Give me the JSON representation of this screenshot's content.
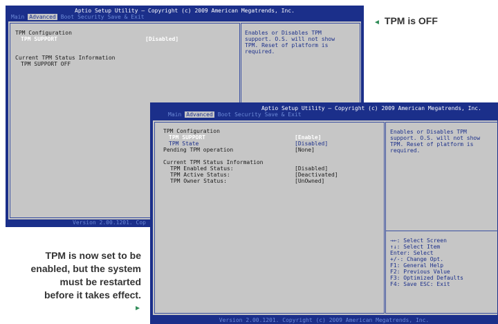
{
  "screen1": {
    "title": "Aptio Setup Utility – Copyright (c) 2009 American Megatrends, Inc.",
    "tabs": [
      "Main",
      "Advanced",
      "Boot",
      "Security",
      "Save & Exit"
    ],
    "section_title": "TPM Configuration",
    "tpm_support_label": "TPM SUPPORT",
    "tpm_support_value": "[Disabled]",
    "status_section": "Current TPM Status Information",
    "status_line": "TPM SUPPORT OFF",
    "help_text": "Enables or Disables TPM support. O.S. will not show TPM. Reset of platform is required.",
    "footer": "Version 2.00.1201. Cop"
  },
  "screen2": {
    "title": "Aptio Setup Utility – Copyright (c) 2009 American Megatrends, Inc.",
    "tabs": [
      "Main",
      "Advanced",
      "Boot",
      "Security",
      "Save & Exit"
    ],
    "section_title": "TPM Configuration",
    "rows": [
      {
        "label": "TPM SUPPORT",
        "value": "[Enable]"
      },
      {
        "label": "TPM State",
        "value": "[Disabled]"
      },
      {
        "label": "Pending TPM operation",
        "value": "[None]"
      }
    ],
    "status_section": "Current TPM Status Information",
    "status_rows": [
      {
        "label": "TPM Enabled Status:",
        "value": "[Disabled]"
      },
      {
        "label": "TPM Active Status:",
        "value": "[Deactivated]"
      },
      {
        "label": "TPM Owner Status:",
        "value": "[UnOwned]"
      }
    ],
    "help_text": "Enables or Disables TPM support. O.S. will not show TPM. Reset of platform is required.",
    "key_help": [
      "→←: Select Screen",
      "↑↓: Select Item",
      "Enter: Select",
      "+/-: Change Opt.",
      "F1: General Help",
      "F2: Previous Value",
      "F3: Optimized Defaults",
      "F4: Save  ESC: Exit"
    ],
    "footer": "Version 2.00.1201. Copyright (c) 2009 American Megatrends, Inc."
  },
  "captions": {
    "tpm_off": "TPM is OFF",
    "tpm_on_l1": "TPM is now set to be",
    "tpm_on_l2": "enabled, but the system",
    "tpm_on_l3": "must be restarted",
    "tpm_on_l4": "before it takes effect.",
    "arrow_left": "◄",
    "arrow_right": "►"
  }
}
